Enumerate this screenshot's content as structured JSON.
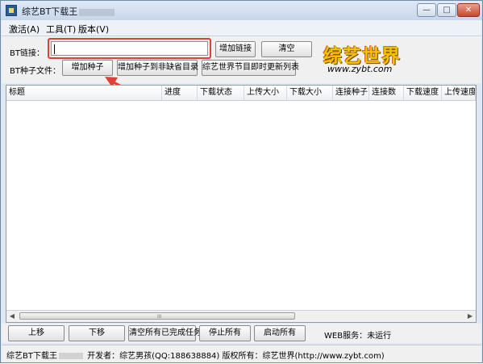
{
  "window": {
    "title_prefix": "综艺BT下载王"
  },
  "titlebar_buttons": {
    "minimize": "—",
    "maximize": "□",
    "close": "✕"
  },
  "menu": [
    {
      "label": "激活(A)"
    },
    {
      "label": "工具(T)"
    },
    {
      "label": "版本(V)"
    }
  ],
  "toolbar": {
    "bt_link_label": "BT链接：",
    "bt_link_value": "",
    "add_link": "增加链接",
    "clear": "清空",
    "torrent_file_label": "BT种子文件：",
    "add_torrent": "增加种子",
    "add_torrent_dir": "增加种子到非缺省目录",
    "update_list": "综艺世界节目即时更新列表"
  },
  "logo": {
    "main": "综艺世界",
    "url": "www.zybt.com"
  },
  "columns": [
    "标题",
    "进度",
    "下载状态",
    "上传大小",
    "下载大小",
    "连接种子",
    "连接数",
    "下载速度",
    "上传速度"
  ],
  "scrollbar": {
    "grip": "III"
  },
  "bottom_buttons": {
    "move_up": "上移",
    "move_down": "下移",
    "clear_done": "清空所有已完成任务",
    "stop_all": "停止所有",
    "start_all": "启动所有"
  },
  "web_service": {
    "text": "WEB服务：未运行"
  },
  "status": {
    "prefix": "综艺BT下载王",
    "suffix": " 开发者：综艺男孩(QQ:188638884) 版权所有：综艺世界(http://www.zybt.com)"
  },
  "colors": {
    "highlight": "#e0403a",
    "logo_yellow": "#f2c200"
  }
}
